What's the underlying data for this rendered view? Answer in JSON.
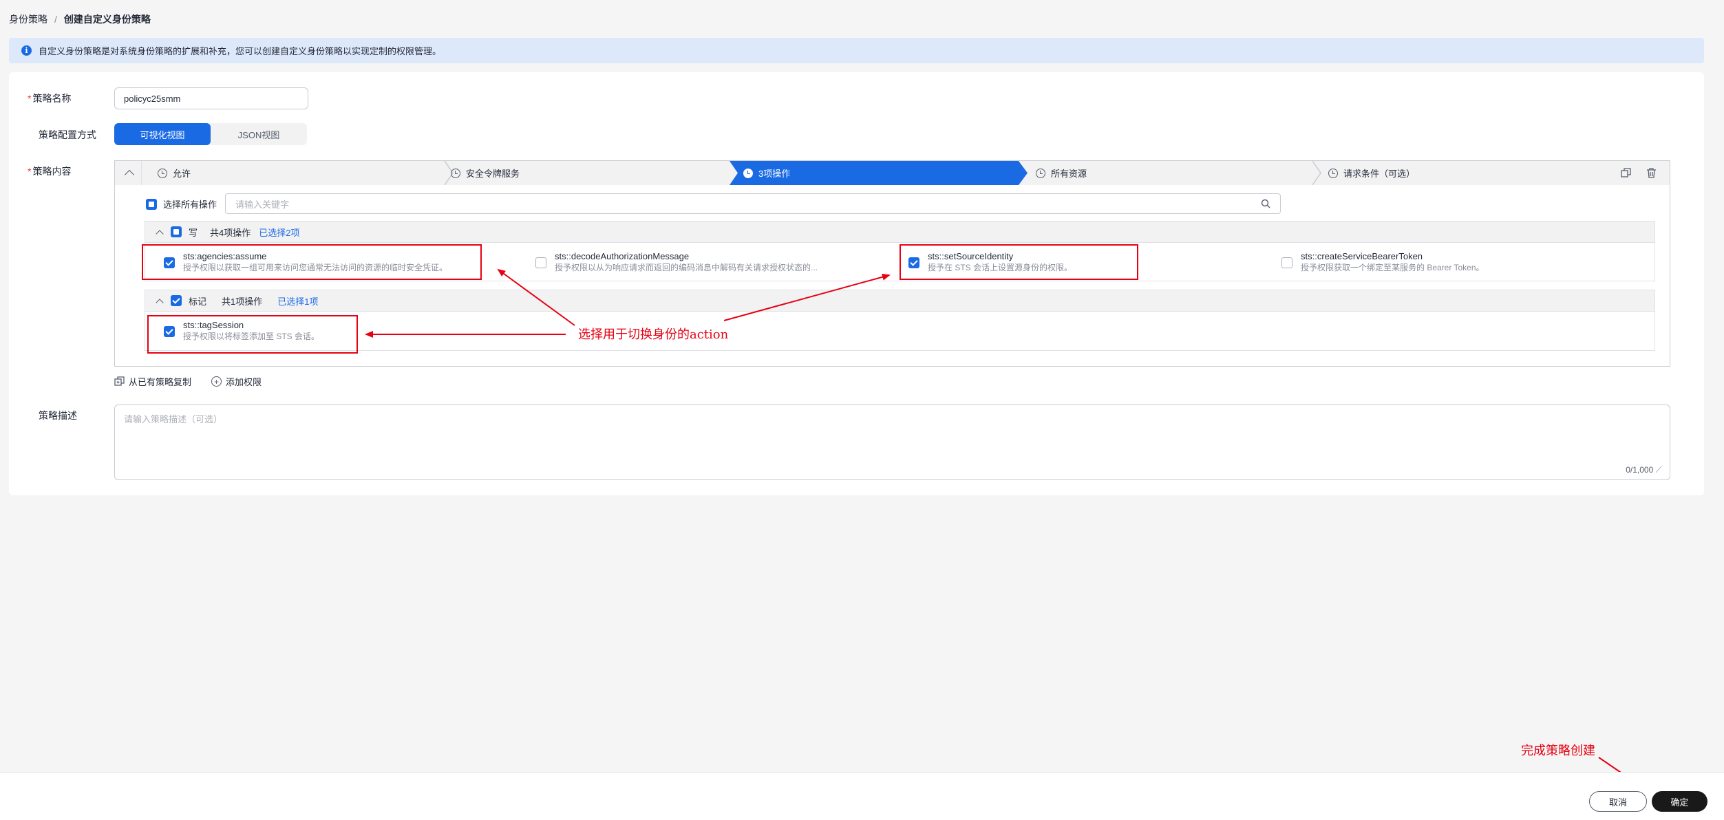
{
  "breadcrumb": {
    "parent": "身份策略",
    "separator": "/",
    "current": "创建自定义身份策略"
  },
  "notice": {
    "text": "自定义身份策略是对系统身份策略的扩展和补充，您可以创建自定义身份策略以实现定制的权限管理。"
  },
  "form": {
    "name_label": "策略名称",
    "name_value": "policyc25smm",
    "mode_label": "策略配置方式",
    "mode_options": [
      "可视化视图",
      "JSON视图"
    ],
    "mode_selected": "可视化视图",
    "content_label": "策略内容",
    "desc_label": "策略描述",
    "desc_placeholder": "请输入策略描述（可选）",
    "desc_counter": "0/1,000"
  },
  "steps": [
    {
      "label": "允许",
      "active": false
    },
    {
      "label": "安全令牌服务",
      "active": false
    },
    {
      "label": "3项操作",
      "active": true
    },
    {
      "label": "所有资源",
      "active": false
    },
    {
      "label": "请求条件（可选）",
      "active": false
    }
  ],
  "actions_panel": {
    "select_all_label": "选择所有操作",
    "search_placeholder": "请输入关键字",
    "groups": [
      {
        "name": "写",
        "total": "共4项操作",
        "selected": "已选择2项",
        "items": [
          {
            "name": "sts:agencies:assume",
            "desc": "授予权限以获取一组可用来访问您通常无法访问的资源的临时安全凭证。",
            "checked": true
          },
          {
            "name": "sts::decodeAuthorizationMessage",
            "desc": "授予权限以从为响应请求而返回的编码消息中解码有关请求授权状态的...",
            "checked": false
          },
          {
            "name": "sts::setSourceIdentity",
            "desc": "授予在 STS 会话上设置源身份的权限。",
            "checked": true
          },
          {
            "name": "sts::createServiceBearerToken",
            "desc": "授予权限获取一个绑定至某服务的 Bearer Token。",
            "checked": false
          }
        ]
      },
      {
        "name": "标记",
        "total": "共1项操作",
        "selected": "已选择1项",
        "items": [
          {
            "name": "sts::tagSession",
            "desc": "授予权限以将标签添加至 STS 会话。",
            "checked": true
          }
        ]
      }
    ]
  },
  "links": {
    "copy": "从已有策略复制",
    "add": "添加权限"
  },
  "footer": {
    "cancel": "取消",
    "ok": "确定"
  },
  "annotations": {
    "select_action": "选择用于切换身份的action",
    "finish": "完成策略创建"
  },
  "colors": {
    "accent": "#1a6ae3",
    "annotation_red": "#e60012",
    "ok_button": "#191919"
  }
}
